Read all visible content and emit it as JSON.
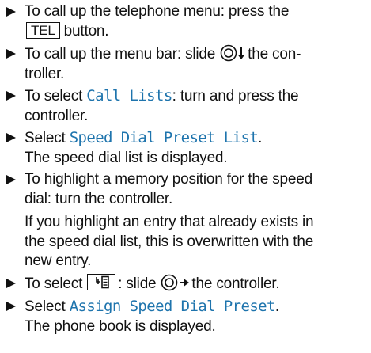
{
  "steps": [
    {
      "line1": "To call up the telephone menu: press the",
      "key": "TEL",
      "after": "button."
    },
    {
      "before": "To call up the menu bar: slide",
      "after": "the con-",
      "line2": "troller."
    },
    {
      "before": "To select",
      "menu": "Call Lists",
      "after": ": turn and press the",
      "line2": "controller."
    },
    {
      "before": "Select",
      "menu": "Speed Dial Preset List",
      "after": ".",
      "line2": "The speed dial list is displayed."
    },
    {
      "line1": "To highlight a memory position for the speed",
      "line2": "dial: turn the controller."
    },
    {
      "note1": "If you highlight an entry that already exists in",
      "note2": "the speed dial list, this is overwritten with the",
      "note3": "new entry."
    },
    {
      "before": "To select",
      "after": ": slide",
      "after2": "the controller."
    },
    {
      "before": "Select",
      "menu": "Assign Speed Dial Preset",
      "after": ".",
      "line2": "The phone book is displayed."
    }
  ],
  "icons": {
    "bullet": "triangle-right-icon",
    "controller": "controller-icon",
    "phonebook_key": "phonebook-key-icon"
  },
  "colors": {
    "menu_text": "#1e74ad",
    "text": "#111111"
  }
}
